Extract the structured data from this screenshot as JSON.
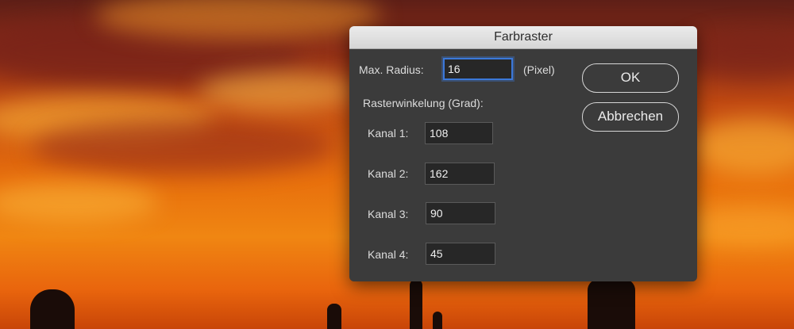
{
  "dialog": {
    "title": "Farbraster",
    "max_radius_label": "Max. Radius:",
    "max_radius_value": "16",
    "unit_label": "(Pixel)",
    "angle_section_label": "Rasterwinkelung (Grad):",
    "channels": [
      {
        "label": "Kanal 1:",
        "value": "108"
      },
      {
        "label": "Kanal 2:",
        "value": "162"
      },
      {
        "label": "Kanal 3:",
        "value": "90"
      },
      {
        "label": "Kanal 4:",
        "value": "45"
      }
    ],
    "ok_label": "OK",
    "cancel_label": "Abbrechen"
  },
  "colors": {
    "dialog_bg": "#3b3b3b",
    "title_bar": "#dcdcdc",
    "focus_ring": "#3b78d9",
    "sky_orange": "#e8700d"
  }
}
